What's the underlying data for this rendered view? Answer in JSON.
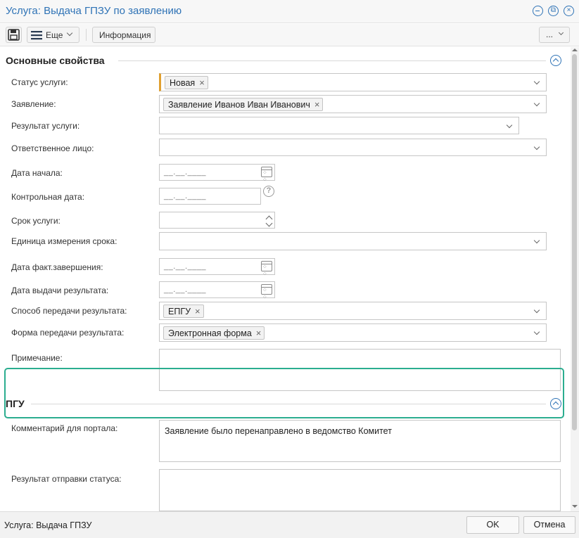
{
  "window": {
    "title": "Услуга: Выдача ГПЗУ по заявлению"
  },
  "toolbar": {
    "more_label": "Еще",
    "info_label": "Информация",
    "overflow_label": "..."
  },
  "sections": {
    "main": {
      "title": "Основные свойства"
    },
    "pgu": {
      "title": "ПГУ"
    }
  },
  "fields": {
    "status": {
      "label": "Статус услуги:",
      "value": "Новая"
    },
    "application": {
      "label": "Заявление:",
      "value": "Заявление Иванов Иван Иванович"
    },
    "result": {
      "label": "Результат услуги:",
      "value": ""
    },
    "responsible": {
      "label": "Ответственное лицо:",
      "value": ""
    },
    "start_date": {
      "label": "Дата начала:",
      "placeholder": "__.__.____"
    },
    "control_date": {
      "label": "Контрольная дата:",
      "placeholder": "__.__.____"
    },
    "term": {
      "label": "Срок услуги:",
      "value": ""
    },
    "term_unit": {
      "label": "Единица измерения срока:",
      "value": ""
    },
    "actual_end": {
      "label": "Дата факт.завершения:",
      "placeholder": "__.__.____"
    },
    "issue_date": {
      "label": "Дата выдачи результата:",
      "placeholder": "__.__.____"
    },
    "delivery_method": {
      "label": "Способ передачи результата:",
      "value": "ЕПГУ"
    },
    "delivery_form": {
      "label": "Форма передачи результата:",
      "value": "Электронная форма"
    },
    "note": {
      "label": "Примечание:",
      "value": ""
    },
    "portal_comment": {
      "label": "Комментарий для портала:",
      "value": "Заявление было перенаправлено в ведомство Комитет"
    },
    "status_send_result": {
      "label": "Результат отправки статуса:",
      "value": ""
    }
  },
  "statusbar": {
    "text": "Услуга: Выдача ГПЗУ",
    "ok_label": "OK",
    "cancel_label": "Отмена"
  },
  "colors": {
    "accent": "#2f73b6",
    "highlight": "#2bad8f",
    "required": "#e0a030"
  }
}
